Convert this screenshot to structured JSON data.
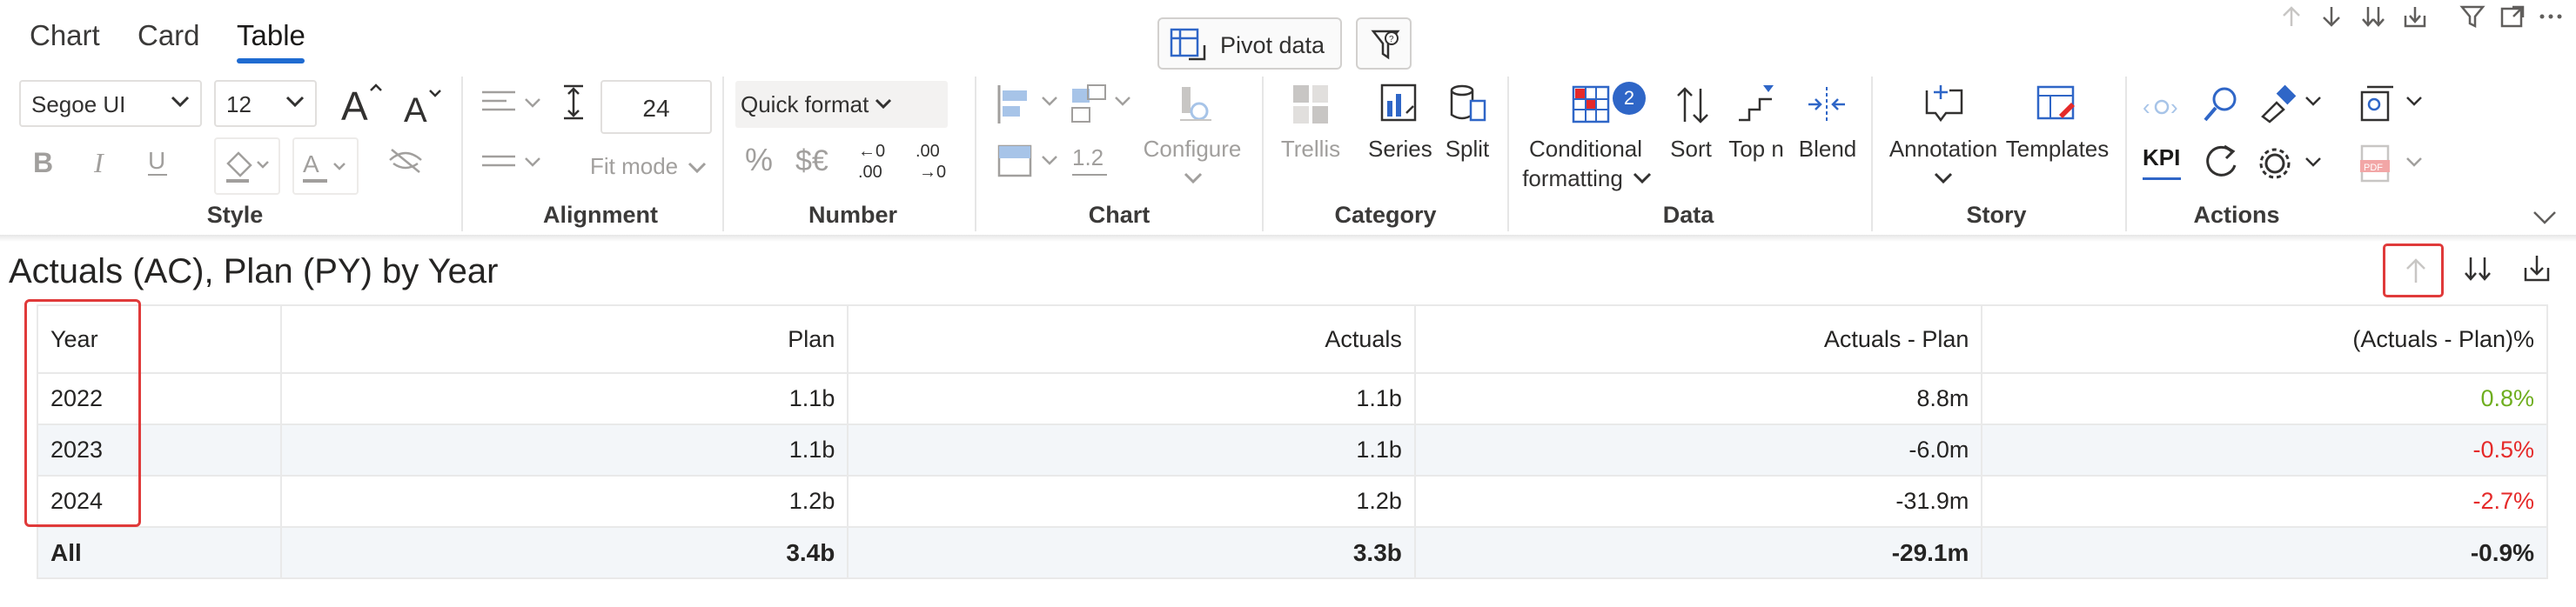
{
  "tabs": [
    {
      "label": "Chart",
      "active": false
    },
    {
      "label": "Card",
      "active": false
    },
    {
      "label": "Table",
      "active": true
    }
  ],
  "toolbar": {
    "pivot_label": "Pivot data",
    "font_family": "Segoe UI",
    "font_size": "12",
    "line_spacing_value": "24",
    "fit_mode_label": "Fit mode",
    "quick_format_label": "Quick format",
    "decimal_value_label": "1.2",
    "configure_label": "Configure",
    "trellis_label": "Trellis",
    "series_label": "Series",
    "split_label": "Split",
    "conditional_label_1": "Conditional",
    "conditional_label_2": "formatting",
    "conditional_badge": "2",
    "sort_label": "Sort",
    "topn_label": "Top n",
    "blend_label": "Blend",
    "annotation_label": "Annotation",
    "templates_label": "Templates",
    "kpi_label": "KPI",
    "accent_color": "#1f6bd1",
    "groups": {
      "style": "Style",
      "alignment": "Alignment",
      "number": "Number",
      "chart": "Chart",
      "category": "Category",
      "data": "Data",
      "story": "Story",
      "actions": "Actions"
    }
  },
  "visual": {
    "title": "Actuals (AC), Plan (PY) by Year",
    "headers": [
      "Year",
      "Plan",
      "Actuals",
      "Actuals - Plan",
      "(Actuals - Plan)%"
    ],
    "rows": [
      [
        "2022",
        "1.1b",
        "1.1b",
        "8.8m",
        "0.8%"
      ],
      [
        "2023",
        "1.1b",
        "1.1b",
        "-6.0m",
        "-0.5%"
      ],
      [
        "2024",
        "1.2b",
        "1.2b",
        "-31.9m",
        "-2.7%"
      ]
    ],
    "total": [
      "All",
      "3.4b",
      "3.3b",
      "-29.1m",
      "-0.9%"
    ],
    "colors": {
      "positive": "#6fae1f",
      "negative": "#e52a2a",
      "highlight": "#e03a3a"
    }
  }
}
